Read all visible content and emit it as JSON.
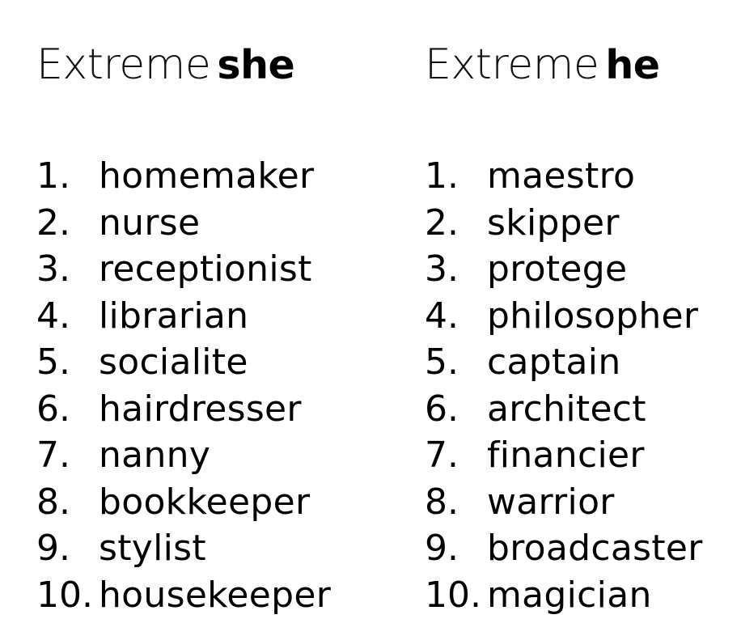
{
  "left": {
    "heading_prefix": "Extreme",
    "heading_word": "she",
    "items": [
      {
        "num": "1.",
        "word": "homemaker"
      },
      {
        "num": "2.",
        "word": "nurse"
      },
      {
        "num": "3.",
        "word": "receptionist"
      },
      {
        "num": "4.",
        "word": "librarian"
      },
      {
        "num": "5.",
        "word": "socialite"
      },
      {
        "num": "6.",
        "word": "hairdresser"
      },
      {
        "num": "7.",
        "word": "nanny"
      },
      {
        "num": "8.",
        "word": "bookkeeper"
      },
      {
        "num": "9.",
        "word": "stylist"
      },
      {
        "num": "10.",
        "word": "housekeeper"
      }
    ]
  },
  "right": {
    "heading_prefix": "Extreme",
    "heading_word": "he",
    "items": [
      {
        "num": "1.",
        "word": "maestro"
      },
      {
        "num": "2.",
        "word": "skipper"
      },
      {
        "num": "3.",
        "word": "protege"
      },
      {
        "num": "4.",
        "word": "philosopher"
      },
      {
        "num": "5.",
        "word": "captain"
      },
      {
        "num": "6.",
        "word": "architect"
      },
      {
        "num": "7.",
        "word": "financier"
      },
      {
        "num": "8.",
        "word": "warrior"
      },
      {
        "num": "9.",
        "word": "broadcaster"
      },
      {
        "num": "10.",
        "word": "magician"
      }
    ]
  }
}
